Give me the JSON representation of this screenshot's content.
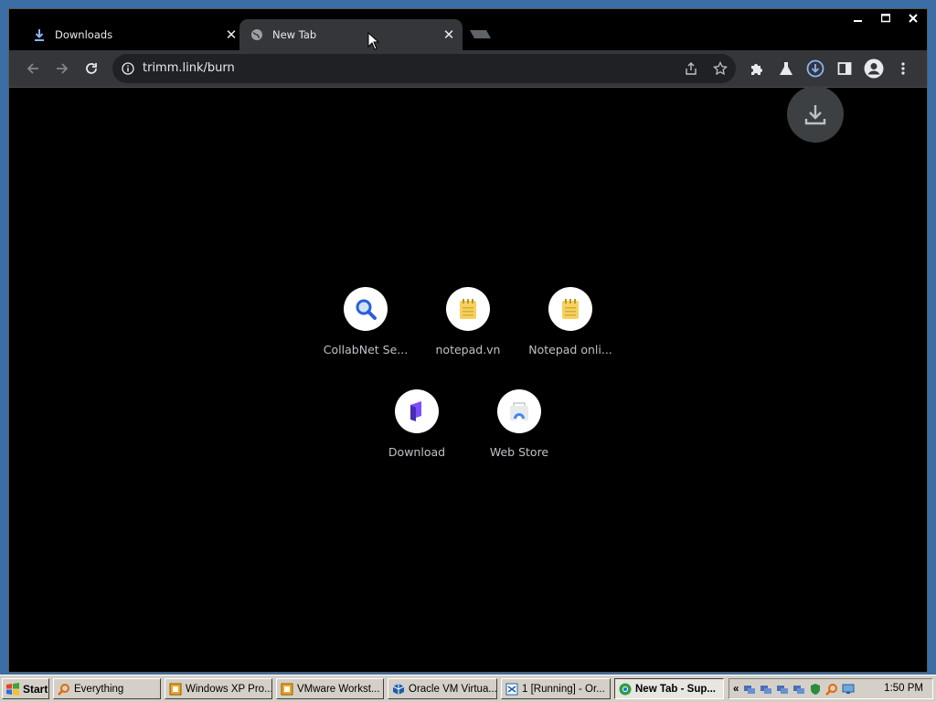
{
  "browser": {
    "tabs": [
      {
        "label": "Downloads",
        "active": false
      },
      {
        "label": "New Tab",
        "active": true
      }
    ],
    "address": "trimm.link/burn",
    "icons": {
      "back": "arrow-left-icon",
      "forward": "arrow-right-icon",
      "reload": "reload-icon",
      "site_info": "info-icon",
      "share": "share-icon",
      "bookmark": "star-icon",
      "extensions": "puzzle-icon",
      "labs": "flask-icon",
      "downloads": "download-circle-icon",
      "side_panel": "side-panel-icon",
      "profile": "profile-icon",
      "menu": "kebab-menu-icon"
    }
  },
  "shortcuts": [
    {
      "title": "CollabNet Se...",
      "icon": "magnifier-icon"
    },
    {
      "title": "notepad.vn",
      "icon": "notepad-icon"
    },
    {
      "title": "Notepad onli...",
      "icon": "notepad-icon"
    },
    {
      "title": "Download",
      "icon": "purple-logo-icon"
    },
    {
      "title": "Web Store",
      "icon": "web-store-icon"
    }
  ],
  "taskbar": {
    "start_label": "Start",
    "tasks": [
      {
        "label": "Everything",
        "active": false
      },
      {
        "label": "Windows XP Pro...",
        "active": false
      },
      {
        "label": "VMware Workst...",
        "active": false
      },
      {
        "label": "Oracle VM Virtua...",
        "active": false
      },
      {
        "label": "1 [Running] - Or...",
        "active": false
      },
      {
        "label": "New Tab - Sup...",
        "active": true
      }
    ],
    "clock": "1:50 PM"
  },
  "colors": {
    "desktop": "#3a6ea5",
    "tab_active": "#35363a",
    "toolbar": "#35363a",
    "omnibox": "#202124",
    "download_accent": "#8ab4f8"
  }
}
